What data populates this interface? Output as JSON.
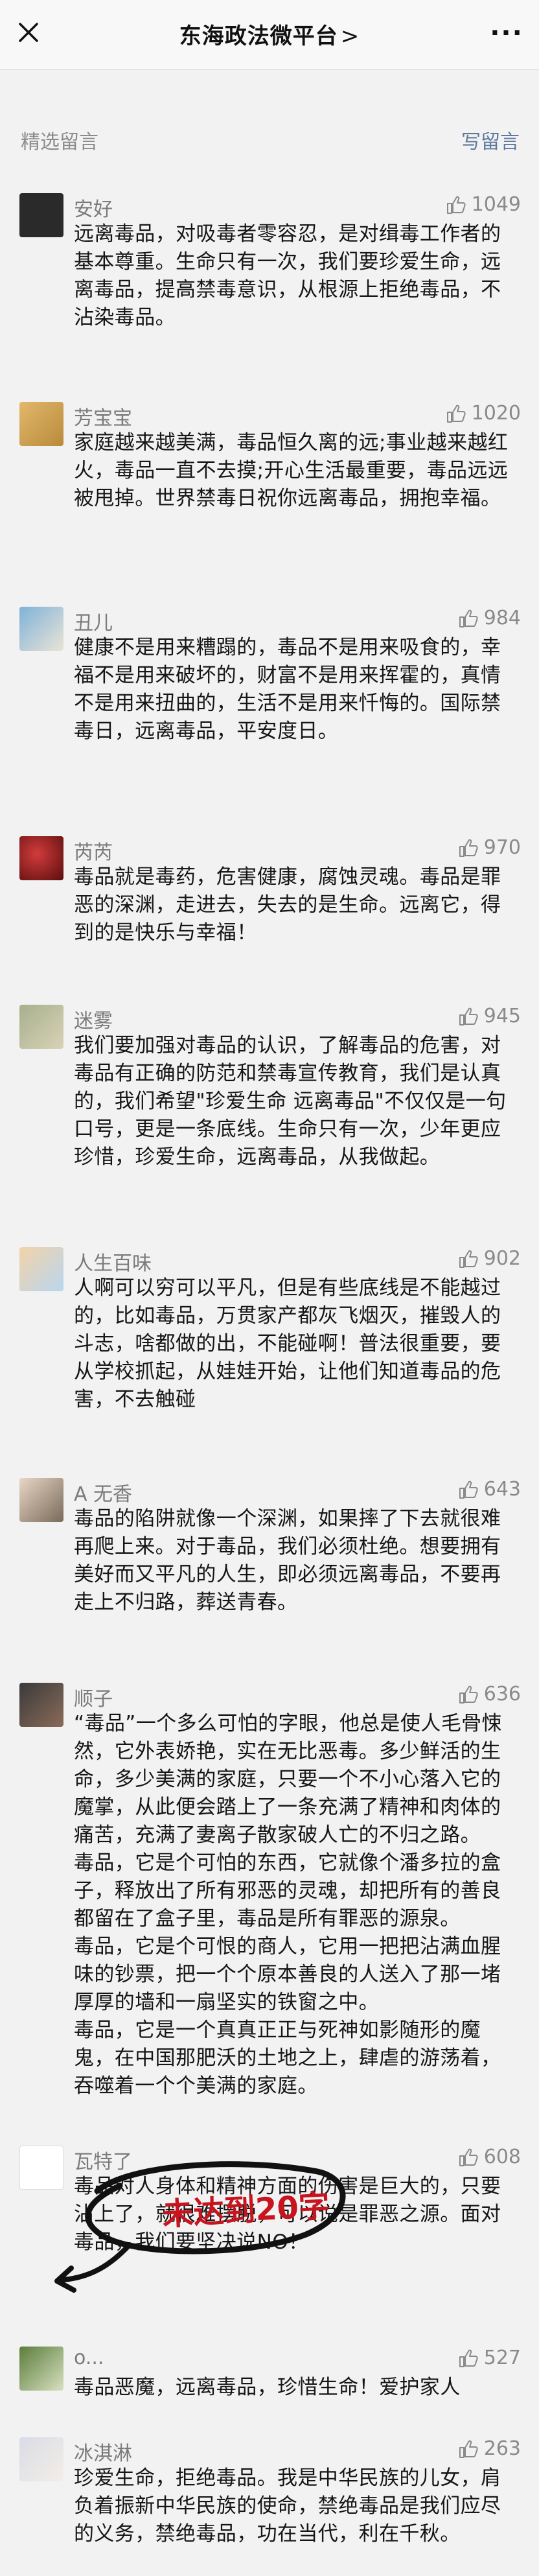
{
  "nav": {
    "title": "东海政法微平台",
    "title_chevron": ">",
    "more": "···"
  },
  "section": {
    "left_label": "精选留言",
    "right_label": "写留言"
  },
  "comments": [
    {
      "nick": "安好",
      "likes": "1049",
      "content": "远离毒品，对吸毒者零容忍，是对缉毒工作者的基本尊重。生命只有一次，我们要珍爱生命，远离毒品，提高禁毒意识，从根源上拒绝毒品，不沾染毒品。"
    },
    {
      "nick": "芳宝宝",
      "likes": "1020",
      "content": "家庭越来越美满，毒品恒久离的远;事业越来越红火，毒品一直不去摸;开心生活最重要，毒品远远被甩掉。世界禁毒日祝你远离毒品，拥抱幸福。"
    },
    {
      "nick": "丑儿",
      "likes": "984",
      "content": "健康不是用来糟蹋的，毒品不是用来吸食的，幸福不是用来破坏的，财富不是用来挥霍的，真情不是用来扭曲的，生活不是用来忏悔的。国际禁毒日，远离毒品，平安度日。"
    },
    {
      "nick": "芮芮",
      "likes": "970",
      "content": "毒品就是毒药，危害健康，腐蚀灵魂。毒品是罪恶的深渊，走进去，失去的是生命。远离它，得到的是快乐与幸福！"
    },
    {
      "nick": "迷雾",
      "likes": "945",
      "content": "我们要加强对毒品的认识，了解毒品的危害，对毒品有正确的防范和禁毒宣传教育，我们是认真的，我们希望\"珍爱生命 远离毒品\"不仅仅是一句口号，更是一条底线。生命只有一次，少年更应珍惜，珍爱生命，远离毒品，从我做起。"
    },
    {
      "nick": "人生百味",
      "likes": "902",
      "content": "人啊可以穷可以平凡，但是有些底线是不能越过的，比如毒品，万贯家产都灰飞烟灭，摧毁人的斗志，啥都做的出，不能碰啊！普法很重要，要从学校抓起，从娃娃开始，让他们知道毒品的危害，不去触碰"
    },
    {
      "nick": "A 无香",
      "likes": "643",
      "content": "毒品的陷阱就像一个深渊，如果摔了下去就很难再爬上来。对于毒品，我们必须杜绝。想要拥有美好而又平凡的人生，即必须远离毒品，不要再走上不归路，葬送青春。"
    },
    {
      "nick": "顺子",
      "likes": "636",
      "content": "“毒品”一个多么可怕的字眼，他总是使人毛骨悚然，它外表娇艳，实在无比恶毒。多少鲜活的生命，多少美满的家庭，只要一个不小心落入它的魔掌，从此便会踏上了一条充满了精神和肉体的痛苦，充满了妻离子散家破人亡的不归之路。\n毒品，它是个可怕的东西，它就像个潘多拉的盒子，释放出了所有邪恶的灵魂，却把所有的善良都留在了盒子里，毒品是所有罪恶的源泉。\n毒品，它是个可恨的商人，它用一把把沾满血腥味的钞票，把一个个原本善良的人送入了那一堵厚厚的墙和一扇坚实的铁窗之中。\n毒品，它是一个真真正正与死神如影随形的魔鬼，在中国那肥沃的土地之上，肆虐的游荡着，吞噬着一个个美满的家庭。"
    },
    {
      "nick": "瓦特了",
      "likes": "608",
      "content": "毒品对人身体和精神方面的伤害是巨大的，只要沾上了，就很难摆脱，可以说是罪恶之源。面对毒品，我们要坚决说NO！"
    },
    {
      "nick": "o...",
      "likes": "527",
      "content": "毒品恶魔，远离毒品，珍惜生命！爱护家人"
    },
    {
      "nick": "冰淇淋",
      "likes": "263",
      "content": "珍爱生命，拒绝毒品。我是中华民族的儿女，肩负着振新中华民族的使命，禁绝毒品是我们应尽的义务，禁绝毒品，功在当代，利在千秋。"
    }
  ],
  "annotation": {
    "text": "未达到20字"
  },
  "colors": {
    "accent": "#5d7a9e",
    "annotation": "#c8141e",
    "like_icon": "#8a8a8a"
  }
}
